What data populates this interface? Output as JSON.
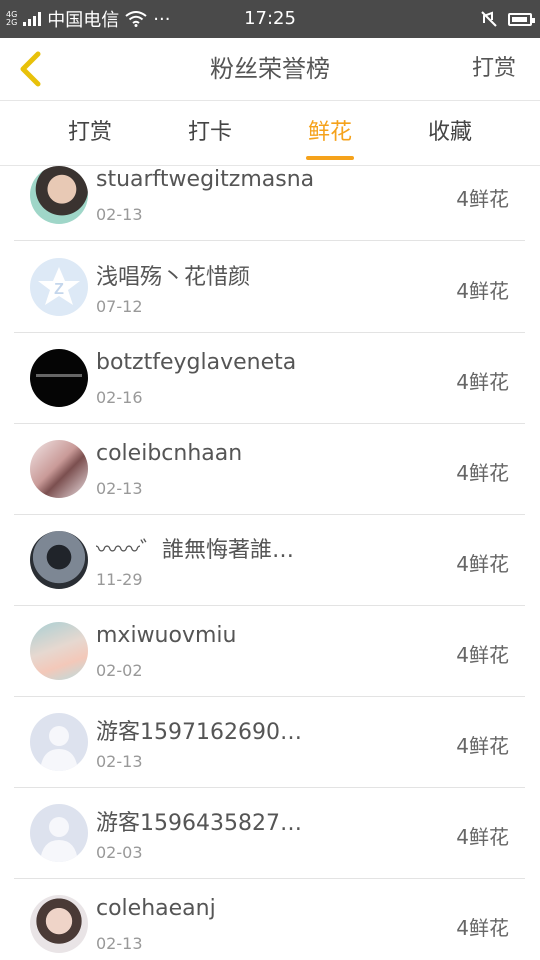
{
  "status_bar": {
    "net_top": "4G",
    "net_bottom": "2G",
    "carrier": "中国电信",
    "more": "···",
    "time": "17:25"
  },
  "nav": {
    "title": "粉丝荣誉榜",
    "action": "打赏"
  },
  "tabs": [
    {
      "label": "打赏",
      "active": false
    },
    {
      "label": "打卡",
      "active": false
    },
    {
      "label": "鲜花",
      "active": true
    },
    {
      "label": "收藏",
      "active": false
    }
  ],
  "list": [
    {
      "name": "stuarftwegitzmasna",
      "date": "02-13",
      "amount": "4鲜花",
      "avatar": "photo-avatar"
    },
    {
      "name": "浅唱殇丶花惜颜",
      "date": "07-12",
      "amount": "4鲜花",
      "avatar": "qzone-avatar"
    },
    {
      "name": "botztfeyglaveneta",
      "date": "02-16",
      "amount": "4鲜花",
      "avatar": "black-text-avatar"
    },
    {
      "name": "coleibcnhaan",
      "date": "02-13",
      "amount": "4鲜花",
      "avatar": "photo-avatar"
    },
    {
      "name": "〰〰゛誰無悔著誰…",
      "date": "11-29",
      "amount": "4鲜花",
      "avatar": "photo-avatar"
    },
    {
      "name": "mxiwuovmiu",
      "date": "02-02",
      "amount": "4鲜花",
      "avatar": "photo-avatar"
    },
    {
      "name": "游客1597162690…",
      "date": "02-13",
      "amount": "4鲜花",
      "avatar": "default-avatar"
    },
    {
      "name": "游客1596435827…",
      "date": "02-03",
      "amount": "4鲜花",
      "avatar": "default-avatar"
    },
    {
      "name": "colehaeanj",
      "date": "02-13",
      "amount": "4鲜花",
      "avatar": "photo-avatar"
    }
  ],
  "colors": {
    "accent": "#f5a21b",
    "status_bar": "#4a4a4a",
    "back_icon": "#e8c10a"
  }
}
